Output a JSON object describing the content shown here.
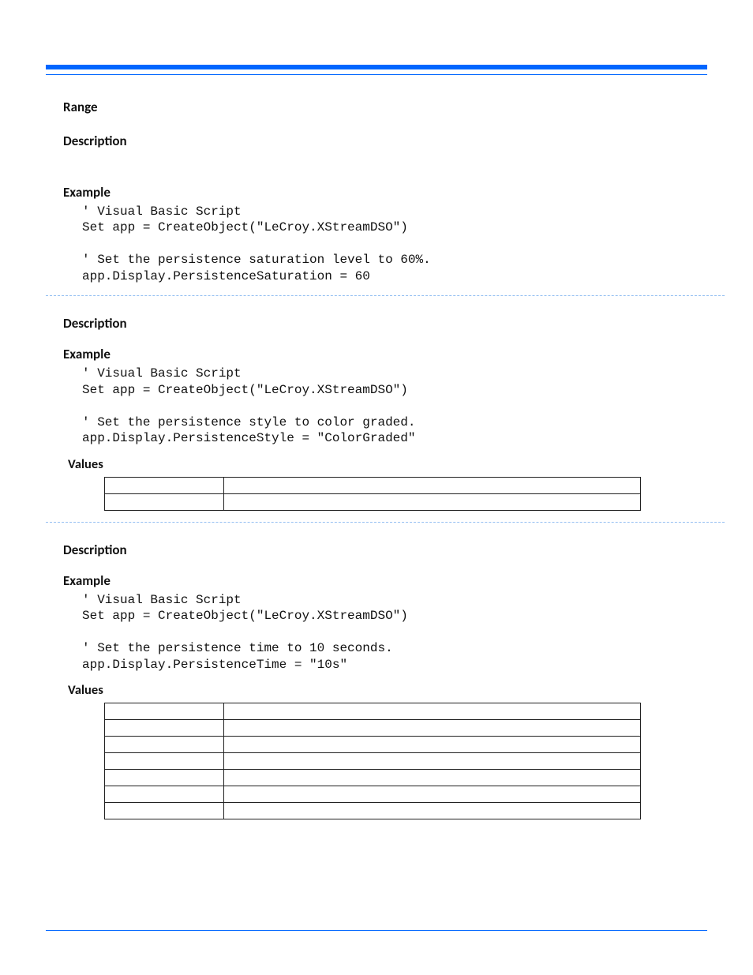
{
  "section1": {
    "range_label": "Range",
    "description_label": "Description",
    "example_label": "Example",
    "code": "' Visual Basic Script\nSet app = CreateObject(\"LeCroy.XStreamDSO\")\n\n' Set the persistence saturation level to 60%.\napp.Display.PersistenceSaturation = 60"
  },
  "section2": {
    "description_label": "Description",
    "example_label": "Example",
    "code": "' Visual Basic Script\nSet app = CreateObject(\"LeCroy.XStreamDSO\")\n\n' Set the persistence style to color graded.\napp.Display.PersistenceStyle = \"ColorGraded\"",
    "values_label": "Values",
    "values_rows": [
      [
        "",
        ""
      ],
      [
        "",
        ""
      ]
    ]
  },
  "section3": {
    "description_label": "Description",
    "example_label": "Example",
    "code": "' Visual Basic Script\nSet app = CreateObject(\"LeCroy.XStreamDSO\")\n\n' Set the persistence time to 10 seconds.\napp.Display.PersistenceTime = \"10s\"",
    "values_label": "Values",
    "values_rows": [
      [
        "",
        ""
      ],
      [
        "",
        ""
      ],
      [
        "",
        ""
      ],
      [
        "",
        ""
      ],
      [
        "",
        ""
      ],
      [
        "",
        ""
      ],
      [
        "",
        ""
      ]
    ]
  }
}
